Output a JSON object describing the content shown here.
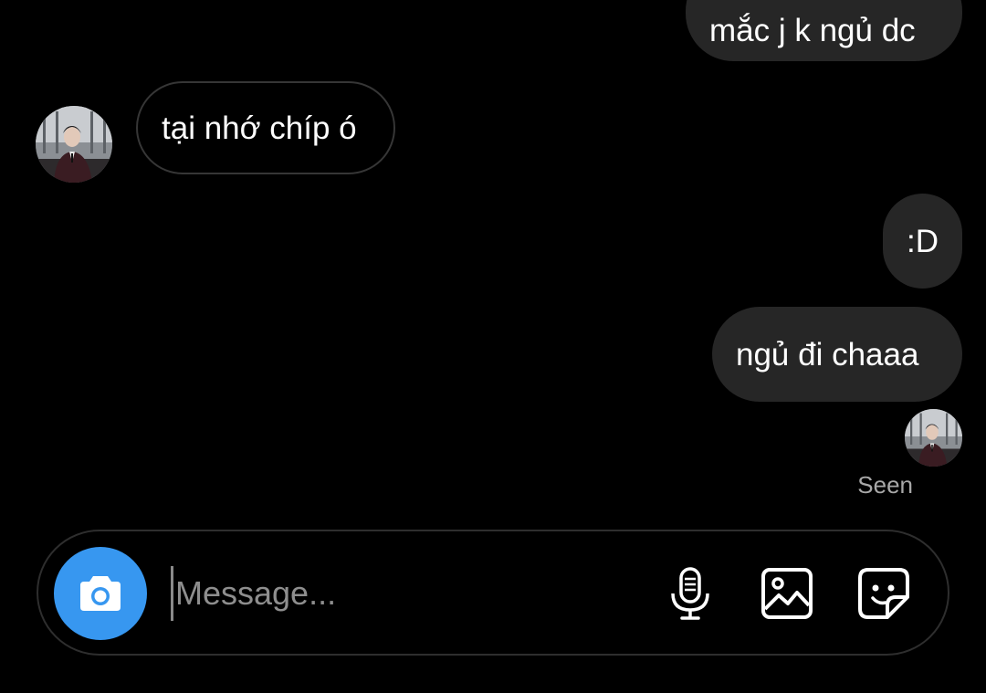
{
  "thread": {
    "messages": [
      {
        "direction": "sent",
        "text": "mắc j k ngủ dc"
      },
      {
        "direction": "received",
        "text": "tại nhớ chíp ó"
      },
      {
        "direction": "sent",
        "text": ":D"
      },
      {
        "direction": "sent",
        "text": "ngủ đi chaaa"
      }
    ],
    "seen_label": "Seen"
  },
  "composer": {
    "placeholder": "Message...",
    "value": "",
    "icons": {
      "camera": "camera-icon",
      "mic": "microphone-icon",
      "gallery": "image-icon",
      "sticker": "sticker-icon"
    }
  },
  "colors": {
    "background": "#000000",
    "sent_bubble": "#262626",
    "received_border": "#363636",
    "accent": "#3797f0",
    "seen_text": "#a8a8a8"
  }
}
